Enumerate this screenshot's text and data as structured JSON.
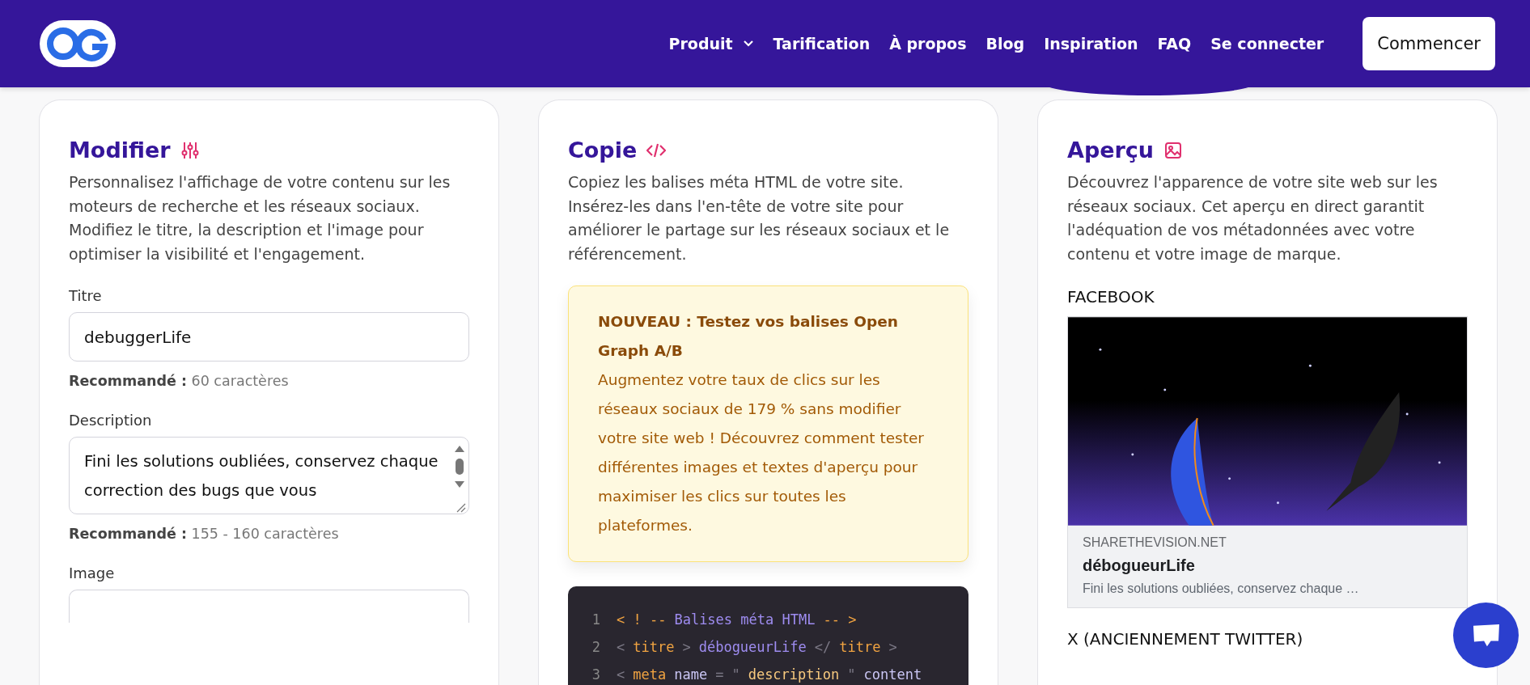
{
  "header": {
    "nav": [
      {
        "label": "Produit",
        "dropdown": true
      },
      {
        "label": "Tarification",
        "dropdown": false
      },
      {
        "label": "À propos",
        "dropdown": false
      },
      {
        "label": "Blog",
        "dropdown": false
      },
      {
        "label": "Inspiration",
        "dropdown": false
      },
      {
        "label": "FAQ",
        "dropdown": false
      },
      {
        "label": "Se connecter",
        "dropdown": false
      }
    ],
    "cta": "Commencer"
  },
  "cards": [
    {
      "kind": "editor",
      "title": "Modifier",
      "description": "Personnalisez l'affichage de votre contenu sur les moteurs de recherche et les réseaux sociaux. Modifiez le titre, la description et l'image pour optimiser la visibilité et l'engagement.",
      "fields": [
        {
          "kind": "input",
          "label": "Titre",
          "value": "debuggerLife",
          "hint_label": "Recommandé :",
          "hint": "60 caractères"
        },
        {
          "kind": "textarea",
          "label": "Description",
          "value": "Fini les solutions oubliées, conservez chaque correction des bugs que vous",
          "hint_label": "Recommandé :",
          "hint": "155 - 160 caractères"
        },
        {
          "kind": "file",
          "label": "Image"
        }
      ]
    },
    {
      "kind": "code",
      "title": "Copie",
      "description": "Copiez les balises méta HTML de votre site. Insérez-les dans l'en-tête de votre site pour améliorer le partage sur les réseaux sociaux et le référencement.",
      "notice": {
        "heading": "NOUVEAU : Testez vos balises Open Graph A/B",
        "body": "Augmentez votre taux de clics sur les réseaux sociaux de 179 % sans modifier votre site web ! Découvrez comment tester différentes images et textes d'aperçu pour maximiser les clics sur toutes les plateformes."
      },
      "code": [
        {
          "number": "1",
          "tokens": [
            {
              "text": "< ! --",
              "kind": "comment-mark"
            },
            {
              "text": "Balises méta HTML",
              "kind": "comment"
            },
            {
              "text": "-- >",
              "kind": "comment-mark"
            }
          ]
        },
        {
          "number": "2",
          "tokens": [
            {
              "text": "<",
              "kind": "punct"
            },
            {
              "text": "titre",
              "kind": "tag"
            },
            {
              "text": ">",
              "kind": "punct"
            },
            {
              "text": "débogueurLife",
              "kind": "comment"
            },
            {
              "text": "</",
              "kind": "punct"
            },
            {
              "text": "titre",
              "kind": "tag"
            },
            {
              "text": ">",
              "kind": "punct"
            }
          ]
        },
        {
          "number": "3",
          "tokens": [
            {
              "text": "<",
              "kind": "punct"
            },
            {
              "text": "meta",
              "kind": "tag"
            },
            {
              "text": "name",
              "kind": "attr"
            },
            {
              "text": "=",
              "kind": "punct"
            },
            {
              "text": "\"",
              "kind": "punct"
            },
            {
              "text": "description",
              "kind": "string"
            },
            {
              "text": "\"",
              "kind": "punct"
            },
            {
              "text": "content",
              "kind": "attr"
            }
          ]
        }
      ]
    },
    {
      "kind": "preview",
      "title": "Aperçu",
      "description": "Découvrez l'apparence de votre site web sur les réseaux sociaux. Cet aperçu en direct garantit l'adéquation de vos métadonnées avec votre contenu et votre image de marque.",
      "previews": [
        {
          "platform": "FACEBOOK",
          "domain": "SHARETHEVISION.NET",
          "title": "débogueurLife",
          "description": "Fini les solutions oubliées, conservez chaque …"
        },
        {
          "platform": "X (ANCIENNEMENT TWITTER)"
        }
      ]
    }
  ]
}
